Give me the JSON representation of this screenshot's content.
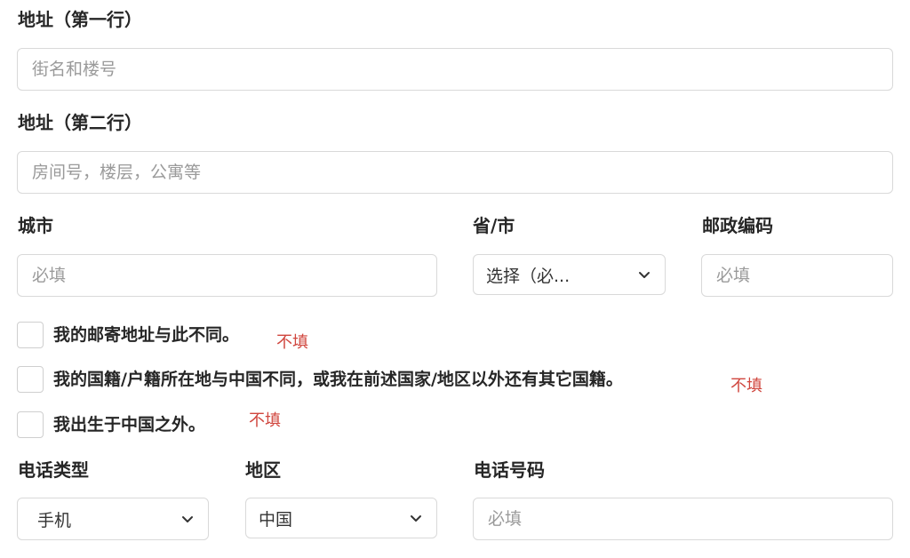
{
  "address1": {
    "label": "地址（第一行）",
    "placeholder": "街名和楼号",
    "value": ""
  },
  "address2": {
    "label": "地址（第二行）",
    "placeholder": "房间号，楼层，公寓等",
    "value": ""
  },
  "city": {
    "label": "城市",
    "placeholder": "必填",
    "value": ""
  },
  "province": {
    "label": "省/市",
    "selected": "选择（必..."
  },
  "postal_code": {
    "label": "邮政编码",
    "placeholder": "必填",
    "value": ""
  },
  "checkboxes": [
    {
      "label": "我的邮寄地址与此不同。",
      "note": "不填",
      "checked": false
    },
    {
      "label": "我的国籍/户籍所在地与中国不同，或我在前述国家/地区以外还有其它国籍。",
      "note": "不填",
      "checked": false
    },
    {
      "label": "我出生于中国之外。",
      "note": "不填",
      "checked": false
    }
  ],
  "phone_type": {
    "label": "电话类型",
    "selected": "手机"
  },
  "region": {
    "label": "地区",
    "selected": "中国"
  },
  "phone_number": {
    "label": "电话号码",
    "placeholder": "必填",
    "value": ""
  },
  "colors": {
    "note": "#d0463e",
    "border": "#d9d9d9",
    "placeholder": "#9a9a9a"
  }
}
